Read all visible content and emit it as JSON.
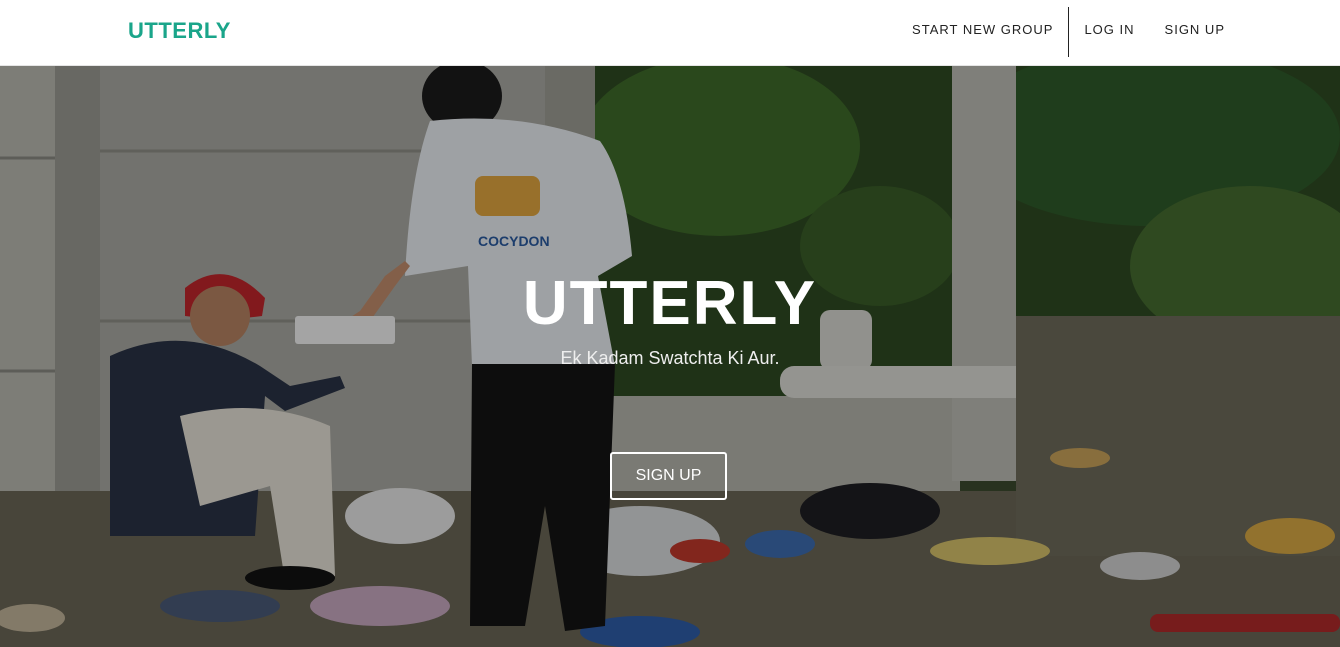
{
  "navbar": {
    "brand": "UTTERLY",
    "links": [
      {
        "label": "START NEW GROUP"
      },
      {
        "label": "LOG IN"
      },
      {
        "label": "SIGN UP"
      }
    ]
  },
  "hero": {
    "title": "UTTERLY",
    "subtitle": "Ek Kadam Swatchta Ki Aur.",
    "button_label": "SIGN UP",
    "shirt_logo_text": "COCYDON"
  },
  "colors": {
    "brand": "#1aa58a",
    "nav_text": "#222222",
    "hero_text": "#ffffff"
  }
}
